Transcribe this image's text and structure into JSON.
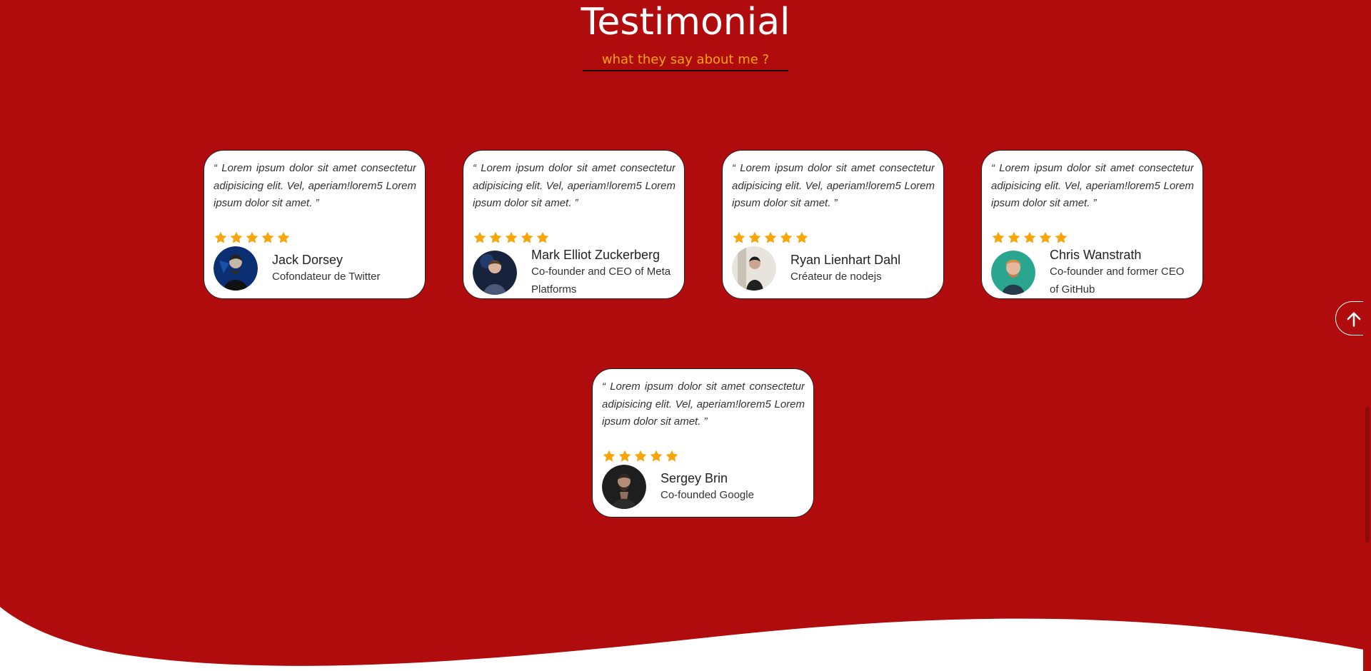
{
  "header": {
    "title": "Testimonial",
    "subtitle": "what they say about me ?"
  },
  "colors": {
    "background": "#b00c0d",
    "card_background": "#ffffff",
    "star": "#f6a60d",
    "subtitle": "#f6a60d",
    "title": "#ffffff"
  },
  "testimonials": [
    {
      "quote": "“ Lorem ipsum dolor sit amet consectetur adipisicing elit. Vel, aperiam!lorem5 Lorem ipsum dolor sit amet. ”",
      "rating": 5,
      "name": "Jack Dorsey",
      "role": "Cofondateur de Twitter",
      "avatar": "jack-dorsey-avatar"
    },
    {
      "quote": "“ Lorem ipsum dolor sit amet consectetur adipisicing elit. Vel, aperiam!lorem5 Lorem ipsum dolor sit amet. ”",
      "rating": 5,
      "name": "Mark Elliot Zuckerberg",
      "role": "Co-founder and CEO of Meta Platforms",
      "avatar": "mark-zuckerberg-avatar"
    },
    {
      "quote": "“ Lorem ipsum dolor sit amet consectetur adipisicing elit. Vel, aperiam!lorem5 Lorem ipsum dolor sit amet. ”",
      "rating": 5,
      "name": "Ryan Lienhart Dahl",
      "role": "Créateur de nodejs",
      "avatar": "ryan-dahl-avatar"
    },
    {
      "quote": "“ Lorem ipsum dolor sit amet consectetur adipisicing elit. Vel, aperiam!lorem5 Lorem ipsum dolor sit amet. ”",
      "rating": 5,
      "name": "Chris Wanstrath",
      "role": "Co-founder and former CEO of GitHub",
      "avatar": "chris-wanstrath-avatar"
    },
    {
      "quote": "“ Lorem ipsum dolor sit amet consectetur adipisicing elit. Vel, aperiam!lorem5 Lorem ipsum dolor sit amet. ”",
      "rating": 5,
      "name": "Sergey Brin",
      "role": "Co-founded Google",
      "avatar": "sergey-brin-avatar"
    }
  ],
  "back_to_top": {
    "icon": "arrow-up-icon"
  }
}
